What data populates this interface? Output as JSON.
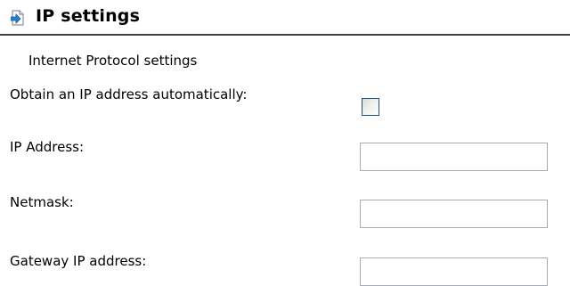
{
  "header": {
    "title": "IP settings",
    "icon": "document-arrow-icon"
  },
  "section": {
    "title": "Internet Protocol settings"
  },
  "fields": {
    "dhcp": {
      "label": "Obtain an IP address automatically:",
      "checked": false
    },
    "ip_address": {
      "label": "IP Address:",
      "value": ""
    },
    "netmask": {
      "label": "Netmask:",
      "value": ""
    },
    "gateway": {
      "label": "Gateway IP address:",
      "value": ""
    }
  },
  "colors": {
    "header_rule": "#404040",
    "icon_blue": "#2a7fd4",
    "checkbox_border": "#1c5180",
    "field_border": "#a5acb5"
  }
}
